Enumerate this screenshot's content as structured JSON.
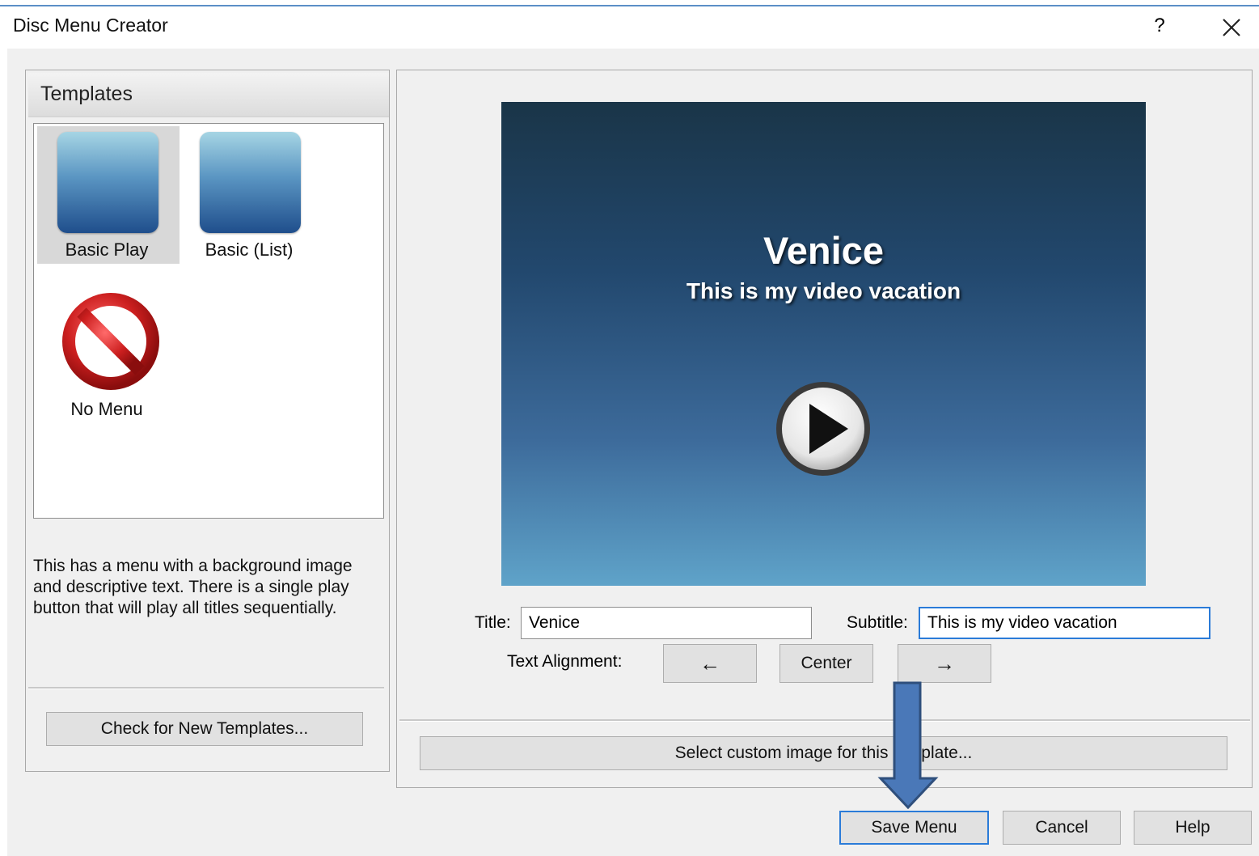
{
  "window": {
    "title": "Disc Menu Creator",
    "help_glyph": "?"
  },
  "templates": {
    "header": "Templates",
    "items": [
      {
        "label": "Basic Play",
        "selected": true
      },
      {
        "label": "Basic (List)",
        "selected": false
      },
      {
        "label": "No Menu",
        "selected": false
      }
    ],
    "description": "This has a menu with a background image and descriptive text. There is a single play button that will play all titles sequentially.",
    "check_button": "Check for New Templates..."
  },
  "preview": {
    "title": "Venice",
    "subtitle": "This is my video vacation",
    "play_icon": "play-icon"
  },
  "form": {
    "title_label": "Title:",
    "title_value": "Venice",
    "subtitle_label": "Subtitle:",
    "subtitle_value": "This is my video vacation",
    "alignment_label": "Text Alignment:",
    "align_left": "←",
    "align_center": "Center",
    "align_right": "→",
    "custom_image_button": "Select custom image for this template..."
  },
  "footer": {
    "save": "Save Menu",
    "cancel": "Cancel",
    "help": "Help"
  },
  "colors": {
    "accent": "#2a7bd8",
    "callout_arrow": "#4a78b8",
    "no_menu_red": "#cc1f1f"
  }
}
